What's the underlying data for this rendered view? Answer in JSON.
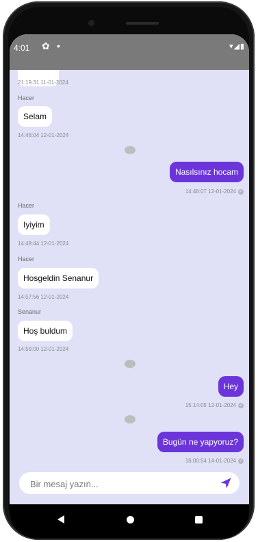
{
  "status_bar": {
    "time": "4:01",
    "settings_icon": "gear-icon",
    "dot": "•",
    "right_icons": "▾◢▮"
  },
  "messages": [
    {
      "type": "in",
      "sender": "",
      "text": "",
      "timestamp": "21:19:31 11-01-2024"
    },
    {
      "type": "in",
      "sender": "Hacer",
      "text": "Selam",
      "timestamp": "14:46:04 12-01-2024"
    },
    {
      "type": "out",
      "sender": "",
      "text": "Nasılsınız hocam",
      "timestamp": "14:48:07 12-01-2024"
    },
    {
      "type": "in",
      "sender": "Hacer",
      "text": "Iyiyim",
      "timestamp": "14:48:44 12-01-2024"
    },
    {
      "type": "in",
      "sender": "Hacer",
      "text": "Hosgeldin Senanur",
      "timestamp": "14:57:56 12-01-2024"
    },
    {
      "type": "in",
      "sender": "Senanur",
      "text": "Hoş buldum",
      "timestamp": "14:59:00 12-01-2024"
    },
    {
      "type": "out",
      "sender": "",
      "text": "Hey",
      "timestamp": "15:14:05 12-01-2024"
    },
    {
      "type": "out",
      "sender": "",
      "text": "Bugün ne yapyoruz?",
      "timestamp": "16:00:54 14-01-2024"
    }
  ],
  "composer": {
    "placeholder": "Bir mesaj yazın...",
    "value": "",
    "send_icon": "send-icon"
  },
  "colors": {
    "background": "#e0e1f7",
    "outgoing_bubble": "#6b35d9",
    "incoming_bubble": "#ffffff",
    "status_bar": "#7a7a7a"
  }
}
